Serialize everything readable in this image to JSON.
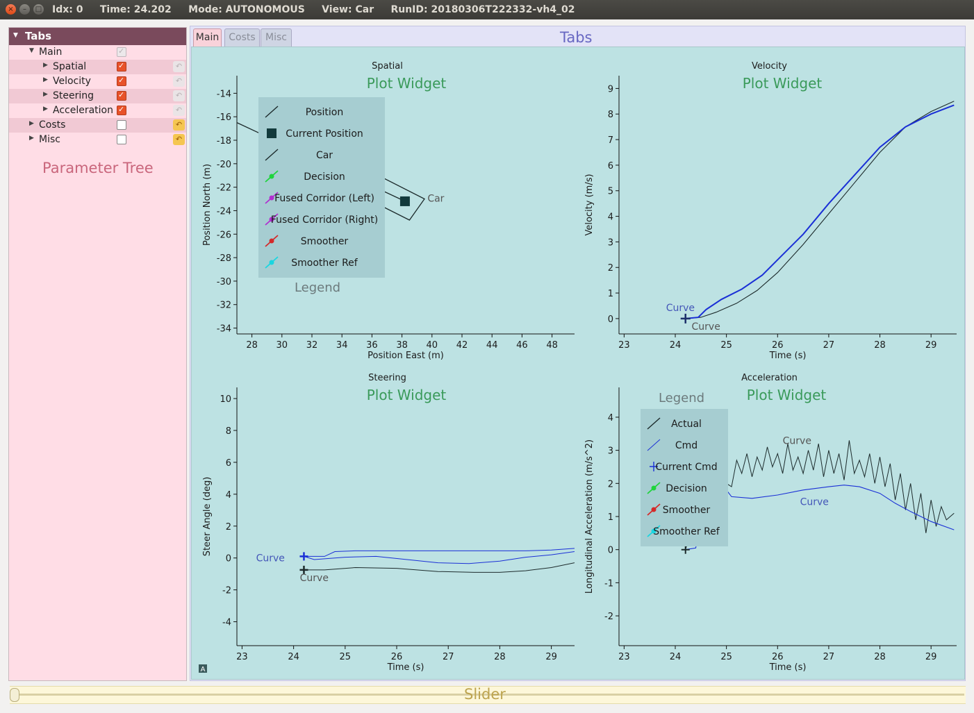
{
  "window": {
    "title": "Idx: 0     Time: 24.202     Mode: AUTONOMOUS     View: Car     RunID: 20180306T222332-vh4_02",
    "close_glyph": "×",
    "min_glyph": "–",
    "max_glyph": "□"
  },
  "tree": {
    "header": "Tabs",
    "title": "Parameter Tree",
    "rows": [
      {
        "label": "Main",
        "checked": true,
        "disabled": true,
        "reset_active": false
      },
      {
        "label": "Spatial",
        "checked": true,
        "disabled": false,
        "reset_active": false
      },
      {
        "label": "Velocity",
        "checked": true,
        "disabled": false,
        "reset_active": false
      },
      {
        "label": "Steering",
        "checked": true,
        "disabled": false,
        "reset_active": false
      },
      {
        "label": "Acceleration",
        "checked": true,
        "disabled": false,
        "reset_active": false
      },
      {
        "label": "Costs",
        "checked": false,
        "disabled": false,
        "reset_active": true
      },
      {
        "label": "Misc",
        "checked": false,
        "disabled": false,
        "reset_active": true
      }
    ]
  },
  "tabs": {
    "title": "Tabs",
    "items": [
      {
        "label": "Main",
        "active": true
      },
      {
        "label": "Costs",
        "active": false
      },
      {
        "label": "Misc",
        "active": false
      }
    ]
  },
  "slider": {
    "title": "Slider",
    "value": 0
  },
  "plots": {
    "widget_label": "Plot Widget",
    "legend_title": "Legend",
    "curve_label": "Curve",
    "car_label": "Car",
    "corner_badge": "A"
  },
  "colors": {
    "plot_bg": "#bde2e3",
    "legend_bg": "#a6cdd1",
    "actual": "#1c2a2b",
    "cmd": "#1a2fd6",
    "widget_label": "#3a9a5a",
    "label_gray": "#6c7a7c",
    "curve_blue": "#4456b8",
    "decision": "#1fd43c",
    "fused": "#b030d0",
    "smoother": "#d42a2a",
    "smoother_ref": "#1ad6e0"
  },
  "chart_data": [
    {
      "type": "line",
      "title": "Spatial",
      "xlabel": "Position East (m)",
      "ylabel": "Position North (m)",
      "xlim": [
        27,
        49.5
      ],
      "ylim": [
        -34.5,
        -12.5
      ],
      "xticks": [
        28,
        30,
        32,
        34,
        36,
        38,
        40,
        42,
        44,
        46,
        48
      ],
      "yticks": [
        -14,
        -16,
        -18,
        -20,
        -22,
        -24,
        -26,
        -28,
        -30,
        -32,
        -34
      ],
      "legend": [
        "Position",
        "Current Position",
        "Car",
        "Decision",
        "Fused Corridor (Left)",
        "Fused Corridor (Right)",
        "Smoother",
        "Smoother Ref"
      ],
      "legend_placement": "top-left",
      "series": [
        {
          "name": "Position",
          "x": [
            27,
            38.2
          ],
          "y": [
            -16.5,
            -23.2
          ]
        },
        {
          "name": "Current Position",
          "x": [
            38.2
          ],
          "y": [
            -23.2
          ]
        },
        {
          "name": "Car",
          "x": [
            35.5,
            39.5,
            38.5,
            34.3,
            35.5
          ],
          "y": [
            -20.4,
            -23.0,
            -24.8,
            -22.1,
            -20.4
          ]
        }
      ]
    },
    {
      "type": "line",
      "title": "Velocity",
      "xlabel": "Time (s)",
      "ylabel": "Velocity (m/s)",
      "xlim": [
        22.9,
        29.5
      ],
      "ylim": [
        -0.6,
        9.5
      ],
      "xticks": [
        23,
        24,
        25,
        26,
        27,
        28,
        29
      ],
      "yticks": [
        0,
        1,
        2,
        3,
        4,
        5,
        6,
        7,
        8,
        9
      ],
      "series": [
        {
          "name": "Actual",
          "x": [
            24.2,
            24.5,
            24.8,
            25.2,
            25.6,
            26.0,
            26.5,
            27.0,
            27.5,
            28.0,
            28.5,
            29.0,
            29.45
          ],
          "y": [
            0,
            0.05,
            0.25,
            0.6,
            1.1,
            1.8,
            2.9,
            4.1,
            5.3,
            6.5,
            7.5,
            8.1,
            8.5
          ]
        },
        {
          "name": "Cmd",
          "x": [
            24.2,
            24.45,
            24.6,
            24.9,
            25.3,
            25.7,
            26.0,
            26.5,
            27.0,
            27.5,
            28.0,
            28.5,
            29.0,
            29.45
          ],
          "y": [
            0,
            0.05,
            0.35,
            0.75,
            1.15,
            1.7,
            2.3,
            3.3,
            4.5,
            5.6,
            6.7,
            7.5,
            8.0,
            8.35
          ]
        }
      ]
    },
    {
      "type": "line",
      "title": "Steering",
      "xlabel": "Time (s)",
      "ylabel": "Steer Angle (deg)",
      "xlim": [
        22.9,
        29.45
      ],
      "ylim": [
        -5.5,
        10.7
      ],
      "xticks": [
        23,
        24,
        25,
        26,
        27,
        28,
        29
      ],
      "yticks": [
        10,
        8,
        6,
        4,
        2,
        0,
        -2,
        -4
      ],
      "series": [
        {
          "name": "Actual",
          "x": [
            24.2,
            24.6,
            24.8,
            25.2,
            26.0,
            26.5,
            27.0,
            28.0,
            28.5,
            29.0,
            29.45
          ],
          "y": [
            0.1,
            0.1,
            0.4,
            0.45,
            0.45,
            0.45,
            0.45,
            0.45,
            0.45,
            0.5,
            0.6
          ]
        },
        {
          "name": "Cmd",
          "x": [
            24.2,
            24.4,
            25.0,
            25.6,
            26.2,
            26.8,
            27.4,
            28.0,
            28.5,
            29.0,
            29.45
          ],
          "y": [
            0.1,
            -0.1,
            0.05,
            0.1,
            -0.1,
            -0.3,
            -0.35,
            -0.2,
            0.05,
            0.2,
            0.4
          ]
        },
        {
          "name": "Smoother",
          "x": [
            24.2,
            24.6,
            25.2,
            26.0,
            26.8,
            27.5,
            28.0,
            28.5,
            29.0,
            29.45
          ],
          "y": [
            -0.75,
            -0.75,
            -0.6,
            -0.65,
            -0.85,
            -0.9,
            -0.9,
            -0.8,
            -0.6,
            -0.3
          ]
        }
      ]
    },
    {
      "type": "line",
      "title": "Acceleration",
      "xlabel": "Time (s)",
      "ylabel": "Longitudinal Acceleration (m/s^2)",
      "xlim": [
        22.9,
        29.5
      ],
      "ylim": [
        -2.9,
        4.9
      ],
      "xticks": [
        23,
        24,
        25,
        26,
        27,
        28,
        29
      ],
      "yticks": [
        4,
        3,
        2,
        1,
        0,
        -1,
        -2
      ],
      "legend": [
        "Actual",
        "Cmd",
        "Current Cmd",
        "Decision",
        "Smoother",
        "Smoother Ref"
      ],
      "legend_placement": "top-left",
      "series": [
        {
          "name": "Actual",
          "x": [
            24.2,
            24.3,
            24.4,
            24.5,
            24.6,
            24.7,
            24.8,
            24.9,
            25.0,
            25.1,
            25.2,
            25.3,
            25.4,
            25.5,
            25.6,
            25.7,
            25.8,
            25.9,
            26.0,
            26.1,
            26.2,
            26.3,
            26.4,
            26.5,
            26.6,
            26.7,
            26.8,
            26.9,
            27.0,
            27.1,
            27.2,
            27.3,
            27.4,
            27.5,
            27.6,
            27.7,
            27.8,
            27.9,
            28.0,
            28.1,
            28.2,
            28.3,
            28.4,
            28.5,
            28.6,
            28.7,
            28.8,
            28.9,
            29.0,
            29.1,
            29.2,
            29.3,
            29.45
          ],
          "y": [
            0.0,
            0.5,
            0.9,
            1.5,
            1.9,
            1.8,
            2.1,
            1.6,
            2.0,
            1.9,
            2.7,
            2.3,
            2.9,
            2.2,
            2.8,
            2.4,
            3.1,
            2.5,
            2.9,
            2.3,
            3.2,
            2.4,
            2.8,
            2.3,
            3.0,
            2.4,
            3.2,
            2.2,
            3.0,
            2.3,
            2.9,
            2.1,
            3.3,
            2.3,
            2.7,
            2.2,
            2.9,
            2.0,
            2.8,
            1.9,
            2.6,
            1.5,
            2.3,
            1.2,
            2.0,
            0.9,
            1.7,
            0.5,
            1.5,
            0.7,
            1.3,
            0.9,
            1.1
          ]
        },
        {
          "name": "Cmd",
          "x": [
            24.2,
            24.4,
            24.6,
            24.8,
            24.9,
            25.0,
            25.1,
            25.5,
            26.0,
            26.5,
            27.0,
            27.3,
            27.6,
            28.0,
            28.3,
            28.6,
            29.0,
            29.45
          ],
          "y": [
            0.0,
            0.05,
            2.0,
            2.0,
            1.95,
            1.8,
            1.6,
            1.55,
            1.65,
            1.8,
            1.9,
            1.95,
            1.9,
            1.7,
            1.4,
            1.15,
            0.85,
            0.6
          ]
        },
        {
          "name": "Current Cmd",
          "x": [
            24.2
          ],
          "y": [
            1.0
          ]
        }
      ]
    }
  ]
}
